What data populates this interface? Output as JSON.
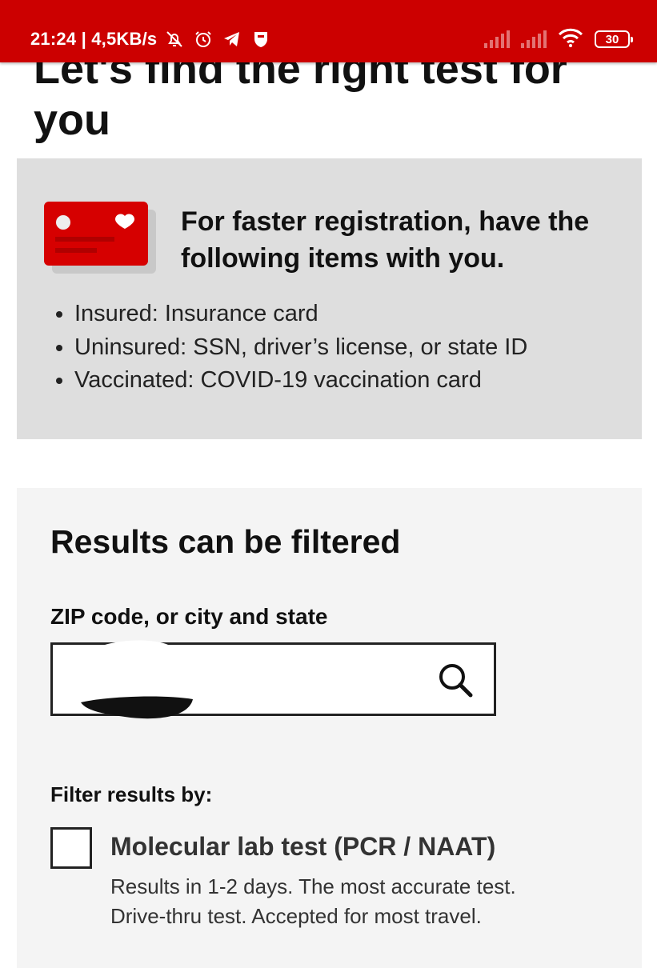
{
  "status_bar": {
    "time_speed": "21:24 | 4,5KB/s",
    "battery": "30",
    "background": "#cc0000"
  },
  "page": {
    "title": "Let's find the right test for you"
  },
  "registration_info": {
    "heading": "For faster registration, have the following items with you.",
    "items": [
      "Insured: Insurance card",
      "Uninsured: SSN, driver’s license, or state ID",
      "Vaccinated: COVID-19 vaccination card"
    ],
    "icon": "health-card-icon",
    "accent": "#d60000",
    "background": "#dedede"
  },
  "filters": {
    "heading": "Results can be filtered",
    "zip_label": "ZIP code, or city and state",
    "zip_value": "",
    "filter_by_label": "Filter results by:",
    "options": [
      {
        "title": "Molecular lab test (PCR / NAAT)",
        "description_lines": [
          "Results in 1-2 days. The most accurate test.",
          "Drive-thru test. Accepted for most travel."
        ],
        "checked": false
      }
    ]
  }
}
